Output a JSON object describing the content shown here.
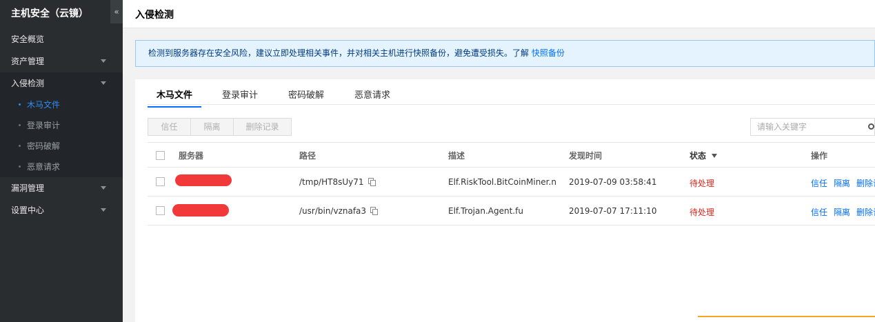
{
  "sidebar": {
    "title": "主机安全（云镜）",
    "collapse_icon": "«",
    "items": [
      {
        "label": "安全概览"
      },
      {
        "label": "资产管理"
      },
      {
        "label": "入侵检测"
      },
      {
        "label": "漏洞管理"
      },
      {
        "label": "设置中心"
      }
    ],
    "sub_items": [
      {
        "label": "木马文件"
      },
      {
        "label": "登录审计"
      },
      {
        "label": "密码破解"
      },
      {
        "label": "恶意请求"
      }
    ]
  },
  "header": {
    "title": "入侵检测"
  },
  "notice": {
    "text": "检测到服务器存在安全风险，建议立即处理相关事件，并对相关主机进行快照备份，避免遭受损失。了解 ",
    "link": "快照备份"
  },
  "tabs": [
    {
      "label": "木马文件"
    },
    {
      "label": "登录审计"
    },
    {
      "label": "密码破解"
    },
    {
      "label": "恶意请求"
    }
  ],
  "toolbar": {
    "trust": "信任",
    "isolate": "隔离",
    "delete_record": "删除记录",
    "search_placeholder": "请输入关键字"
  },
  "table": {
    "headers": {
      "server": "服务器",
      "path": "路径",
      "desc": "描述",
      "time": "发现时间",
      "status": "状态",
      "ops": "操作"
    },
    "rows": [
      {
        "path": "/tmp/HT8sUy71",
        "desc": "Elf.RiskTool.BitCoinMiner.n",
        "time": "2019-07-09 03:58:41",
        "status": "待处理",
        "op_trust": "信任",
        "op_isolate": "隔离",
        "op_delete": "删除记"
      },
      {
        "path": "/usr/bin/vznafa3",
        "desc": "Elf.Trojan.Agent.fu",
        "time": "2019-07-07 17:11:10",
        "status": "待处理",
        "op_trust": "信任",
        "op_isolate": "隔离",
        "op_delete": "删除记"
      }
    ]
  },
  "colors": {
    "sidebar_bg": "#292d2f",
    "accent": "#006eff",
    "status_red": "#e1251b",
    "redaction": "#f2393a"
  }
}
